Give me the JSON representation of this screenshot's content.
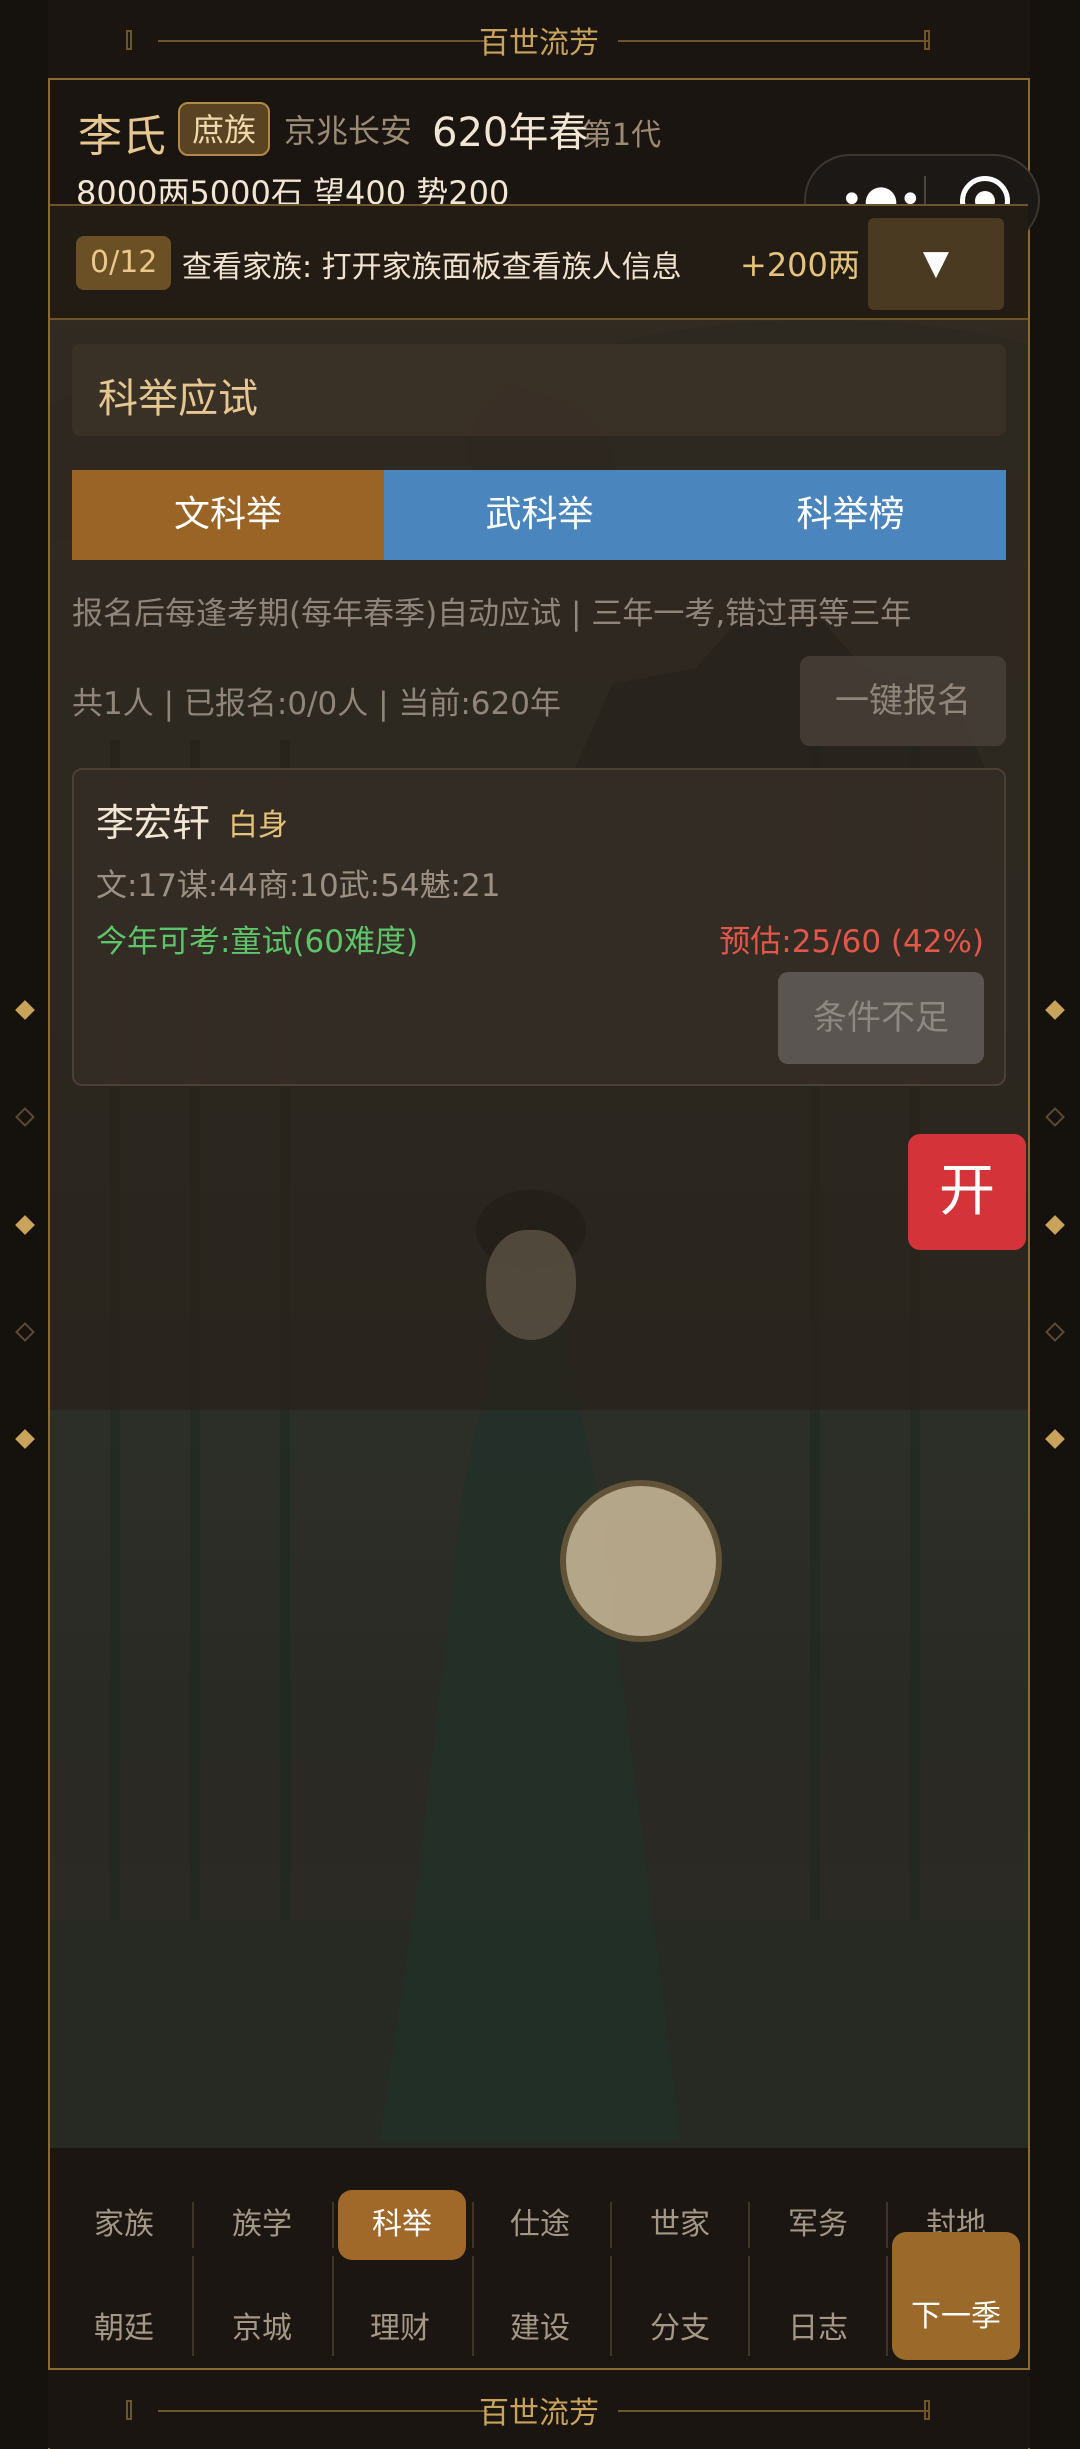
{
  "banner": {
    "title": "百世流芳"
  },
  "header": {
    "clan": "李氏",
    "rank": "庶族",
    "location": "京兆长安",
    "year": "620年春",
    "generation": "第1代",
    "resources": "8000两5000石  望400 势200"
  },
  "capsule": {
    "more_icon": "•●•"
  },
  "task": {
    "count": "0/12",
    "text": "查看家族: 打开家族面板查看族人信息",
    "reward": "+200两",
    "toggle": "▼"
  },
  "exam": {
    "title": "科举应试",
    "tabs": [
      "文科举",
      "武科举",
      "科举榜"
    ],
    "note": "报名后每逢考期(每年春季)自动应试 | 三年一考,错过再等三年",
    "summary": "共1人 | 已报名:0/0人 | 当前:620年",
    "signup_all": "一键报名",
    "candidate": {
      "name": "李宏轩",
      "status": "白身",
      "attributes": "文:17谋:44商:10武:54魅:21",
      "eligible": "今年可考:童试(60难度)",
      "estimate": "预估:25/60 (42%)",
      "action": "条件不足"
    }
  },
  "open_button": "开",
  "nav": {
    "row1": [
      "家族",
      "族学",
      "科举",
      "仕途",
      "世家",
      "军务",
      "封地"
    ],
    "row2": [
      "朝廷",
      "京城",
      "理财",
      "建设",
      "分支",
      "日志"
    ],
    "active": "科举",
    "next": "下一季"
  },
  "colors": {
    "accent_gold": "#c9a35a",
    "tab_active": "#9a6426",
    "tab_inactive": "#4a86bd",
    "positive": "#5ec46a",
    "negative": "#e2574a",
    "open_red": "#d5333a"
  }
}
